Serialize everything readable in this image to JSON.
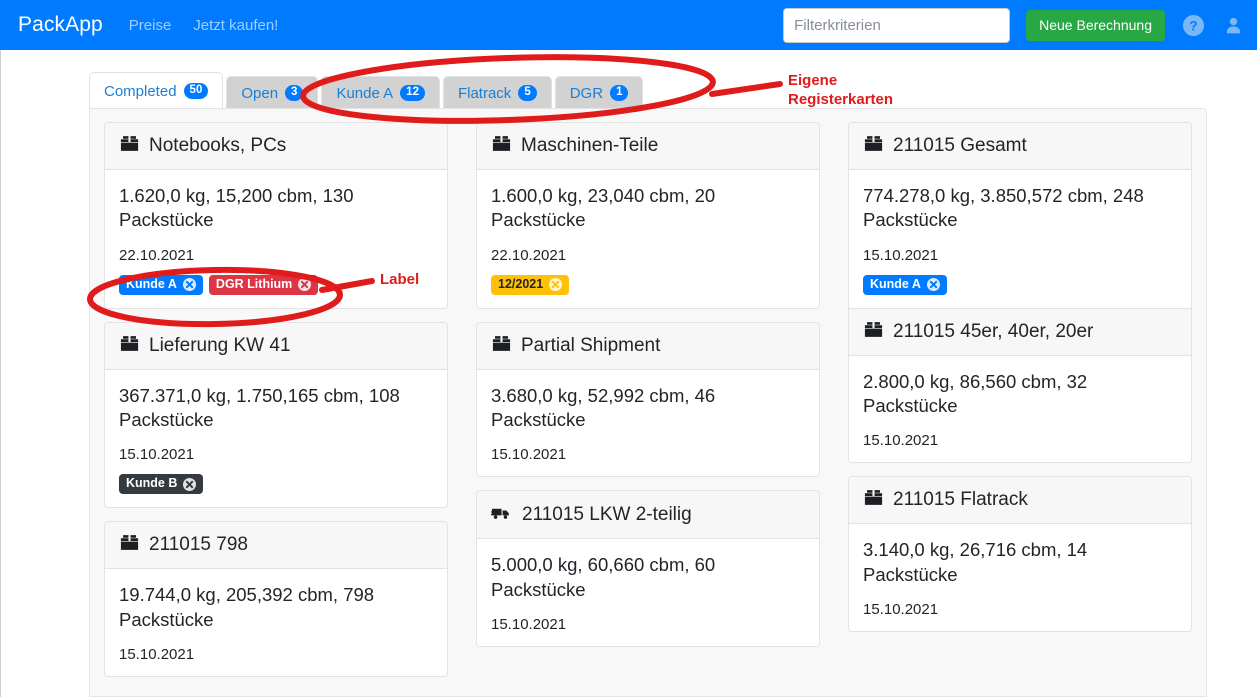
{
  "navbar": {
    "brand": "PackApp",
    "links": [
      "Preise",
      "Jetzt kaufen!"
    ],
    "filter_placeholder": "Filterkriterien",
    "new_calc_button": "Neue Berechnung",
    "help_icon": "help-circle-icon",
    "user_icon": "user-icon",
    "bg_color": "#007bff"
  },
  "tabs": [
    {
      "label": "Completed",
      "count": "50",
      "active": true
    },
    {
      "label": "Open",
      "count": "3",
      "active": false
    },
    {
      "label": "Kunde A",
      "count": "12",
      "active": false
    },
    {
      "label": "Flatrack",
      "count": "5",
      "active": false
    },
    {
      "label": "DGR",
      "count": "1",
      "active": false
    }
  ],
  "annotations": [
    {
      "text": "Eigene\nRegisterkarten",
      "color": "#e01b1b"
    },
    {
      "text": "Label",
      "color": "#e01b1b"
    }
  ],
  "columns": [
    {
      "cards": [
        {
          "icon": "box-icon",
          "title": "Notebooks, PCs",
          "stats": "1.620,0 kg, 15,200 cbm, 130 Packstücke",
          "date": "22.10.2021",
          "labels": [
            {
              "text": "Kunde A",
              "color": "#007bff"
            },
            {
              "text": "DGR Lithium",
              "color": "#dc3545"
            }
          ]
        },
        {
          "icon": "box-icon",
          "title": "Lieferung KW 41",
          "stats": "367.371,0 kg, 1.750,165 cbm, 108 Packstücke",
          "date": "15.10.2021",
          "labels": [
            {
              "text": "Kunde B",
              "color": "#343a40"
            }
          ]
        },
        {
          "icon": "box-icon",
          "title": "211015 798",
          "stats": "19.744,0 kg, 205,392 cbm, 798 Packstücke",
          "date": "15.10.2021",
          "labels": []
        }
      ]
    },
    {
      "cards": [
        {
          "icon": "box-icon",
          "title": "Maschinen-Teile",
          "stats": "1.600,0 kg, 23,040 cbm, 20 Packstücke",
          "date": "22.10.2021",
          "labels": [
            {
              "text": "12/2021",
              "color": "#ffc107"
            }
          ]
        },
        {
          "icon": "box-icon",
          "title": "Partial Shipment",
          "stats": "3.680,0 kg, 52,992 cbm, 46 Packstücke",
          "date": "15.10.2021",
          "labels": []
        },
        {
          "icon": "truck-icon",
          "title": "211015 LKW 2-teilig",
          "stats": "5.000,0 kg, 60,660 cbm, 60 Packstücke",
          "date": "15.10.2021",
          "labels": []
        }
      ]
    },
    {
      "cards": [
        {
          "icon": "box-icon",
          "title": "211015 Gesamt",
          "stats": "774.278,0 kg, 3.850,572 cbm, 248 Packstücke",
          "date": "15.10.2021",
          "labels": [
            {
              "text": "Kunde A",
              "color": "#007bff"
            }
          ]
        },
        {
          "icon": "box-icon",
          "title": "211015 45er, 40er, 20er",
          "stats": "2.800,0 kg, 86,560 cbm, 32 Packstücke",
          "date": "15.10.2021",
          "labels": []
        },
        {
          "icon": "box-icon",
          "title": "211015 Flatrack",
          "stats": "3.140,0 kg, 26,716 cbm, 14 Packstücke",
          "date": "15.10.2021",
          "labels": []
        }
      ]
    }
  ]
}
